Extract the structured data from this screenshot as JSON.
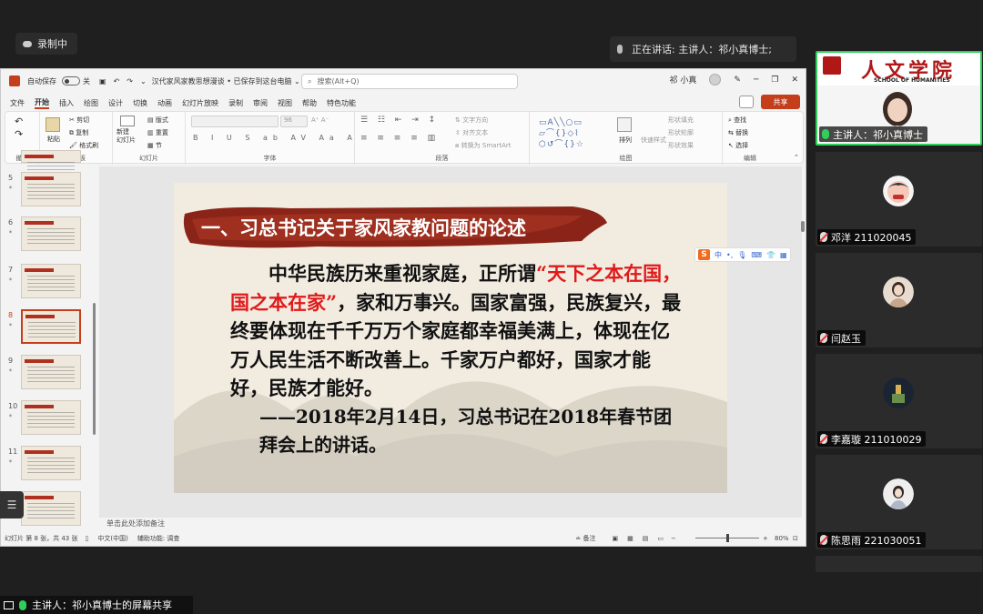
{
  "meeting": {
    "recording_label": "录制中",
    "speaking_label": "正在讲话: 主讲人：祁小真博士;",
    "share_label": "主讲人：祁小真博士的屏幕共享"
  },
  "ppt": {
    "autosave_label": "自动保存",
    "autosave_state": "关",
    "doc_title": "汉代家风家教思想漫谈 • 已保存到这台电脑 ⌄",
    "search_placeholder": "搜索(Alt+Q)",
    "user_name": "祁 小真",
    "menu": [
      "文件",
      "开始",
      "插入",
      "绘图",
      "设计",
      "切换",
      "动画",
      "幻灯片放映",
      "录制",
      "审阅",
      "视图",
      "帮助",
      "特色功能"
    ],
    "active_menu": "开始",
    "share_button": "共享",
    "ribbon": {
      "groups": [
        "撤消",
        "剪贴板",
        "幻灯片",
        "字体",
        "段落",
        "绘图",
        "编辑"
      ],
      "undo": "↶",
      "redo": "↷",
      "paste": "粘贴",
      "cut": "剪切",
      "copy": "复制",
      "format_painter": "格式刷",
      "new_slide": "新建\n幻灯片",
      "layout": "版式",
      "reset": "重置",
      "section": "节",
      "font_size": "96",
      "text_direction": "文字方向",
      "align_text": "对齐文本",
      "smartart": "转换为 SmartArt",
      "arrange": "排列",
      "quick_styles": "快速样式",
      "shape_fill": "形状填充",
      "shape_outline": "形状轮廓",
      "shape_effects": "形状效果",
      "find": "查找",
      "replace": "替换",
      "select": "选择"
    },
    "thumbnails": [
      {
        "num": "5"
      },
      {
        "num": "6"
      },
      {
        "num": "7"
      },
      {
        "num": "8"
      },
      {
        "num": "9"
      },
      {
        "num": "10"
      },
      {
        "num": "11"
      },
      {
        "num": "12"
      }
    ],
    "selected_slide": "8",
    "slide": {
      "title": "一、习总书记关于家风家教问题的论述",
      "body_pre": "中华民族历来重视家庭，正所谓",
      "body_quote": "“天下之本在国，国之本在家”",
      "body_post": "，家和万事兴。国家富强，民族复兴，最终要体现在千千万万个家庭都幸福美满上，体现在亿万人民生活不断改善上。千家万户都好，国家才能好，民族才能好。",
      "source": "——2018年2月14日，习总书记在2018年春节团拜会上的讲话。"
    },
    "notes_placeholder": "单击此处添加备注",
    "status": {
      "slide_count": "幻灯片 第 8 张，共 43 张",
      "language": "中文(中国)",
      "accessibility": "辅助功能: 调查",
      "notes_btn": "备注",
      "zoom": "80%"
    },
    "ime": {
      "logo": "S",
      "mode": "中"
    }
  },
  "participants": {
    "host": {
      "label": "主讲人：祁小真博士",
      "banner_cn": "人文学院",
      "banner_en": "SCHOOL OF HUMANITIES"
    },
    "others": [
      {
        "name": "邓洋 211020045"
      },
      {
        "name": "闫赵玉"
      },
      {
        "name": "李嘉璇 211010029"
      },
      {
        "name": "陈思雨 221030051"
      }
    ]
  }
}
